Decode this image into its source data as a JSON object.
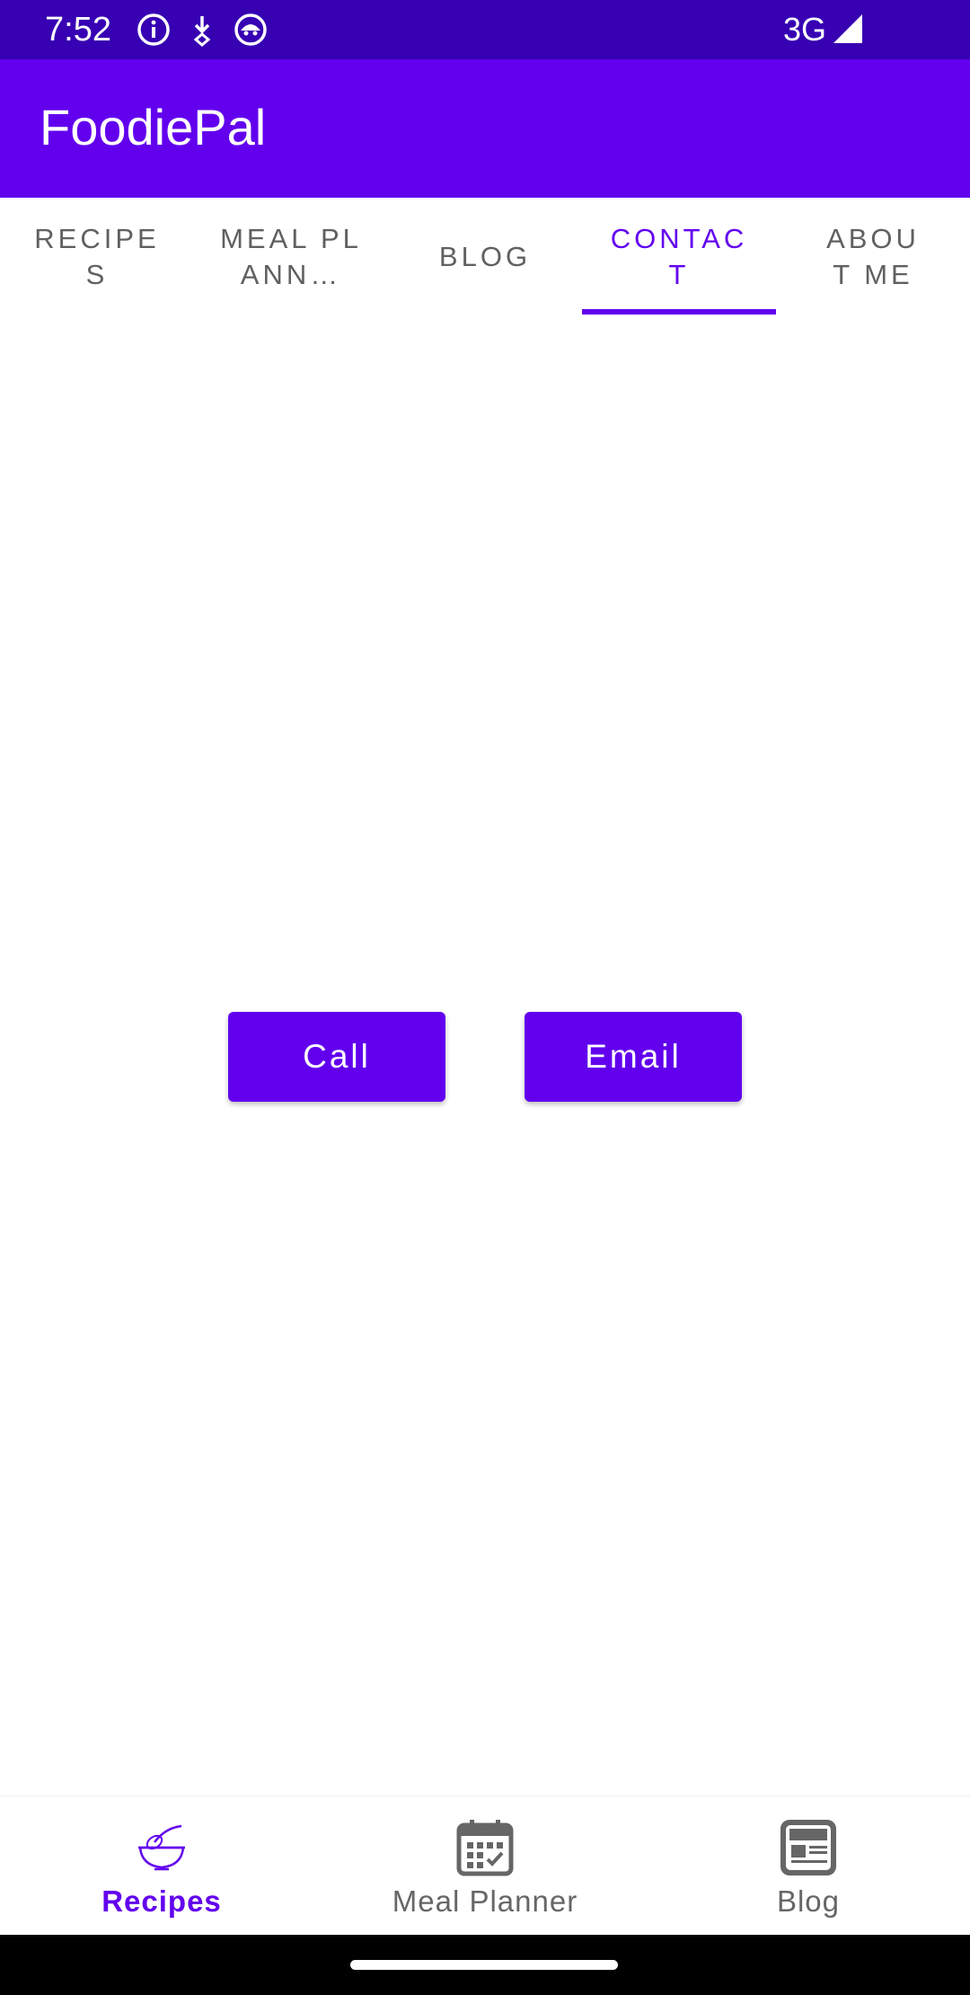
{
  "status_bar": {
    "time": "7:52",
    "network": "3G",
    "icons": [
      "info-icon",
      "download-arrow-icon",
      "android-face-icon",
      "signal-icon"
    ]
  },
  "app_bar": {
    "title": "FoodiePal"
  },
  "tabs": [
    {
      "label": "RECIPES",
      "active": false
    },
    {
      "label": "MEAL PLANN…",
      "active": false
    },
    {
      "label": "BLOG",
      "active": false
    },
    {
      "label": "CONTACT",
      "active": true
    },
    {
      "label": "ABOUT ME",
      "active": false
    }
  ],
  "contact": {
    "call_label": "Call",
    "email_label": "Email"
  },
  "bottom_nav": [
    {
      "label": "Recipes",
      "icon": "mixing-bowl-icon",
      "active": true
    },
    {
      "label": "Meal Planner",
      "icon": "calendar-icon",
      "active": false
    },
    {
      "label": "Blog",
      "icon": "blog-icon",
      "active": false
    }
  ],
  "colors": {
    "primary": "#6200ee",
    "primary_dark": "#3700b3",
    "tab_inactive": "#606060"
  }
}
